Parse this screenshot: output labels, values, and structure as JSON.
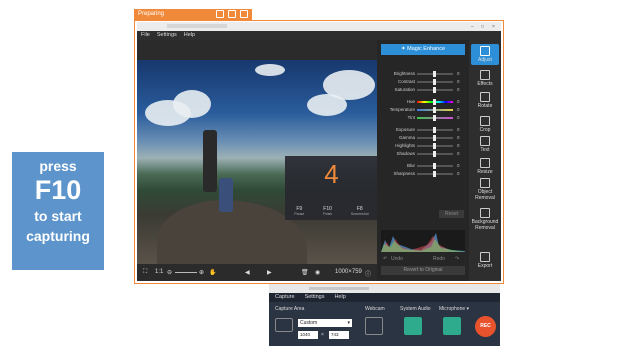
{
  "promo": {
    "line1": "press",
    "line2": "F10",
    "line3": "to start",
    "line4": "capturing"
  },
  "recording_frame": {
    "title": "Preparing",
    "accent": "#f08a3a"
  },
  "editor": {
    "menu": [
      "File",
      "Settings",
      "Help"
    ],
    "countdown": {
      "number": "4",
      "keys": [
        {
          "key": "F9",
          "caption": "Pause"
        },
        {
          "key": "F10",
          "caption": "Finish"
        },
        {
          "key": "F8",
          "caption": "Screenshot"
        }
      ]
    },
    "bottom": {
      "zoom": "1:1",
      "resolution": "1000×759"
    },
    "panel": {
      "magic_enhance": "Magic Enhance",
      "sliders": [
        {
          "label": "Brightness",
          "value": "0"
        },
        {
          "label": "Contrast",
          "value": "0"
        },
        {
          "label": "Saturation",
          "value": "0"
        },
        {
          "label": "Hue",
          "value": "0"
        },
        {
          "label": "Temperature",
          "value": "0"
        },
        {
          "label": "Tint",
          "value": "0"
        },
        {
          "label": "Exposure",
          "value": "0"
        },
        {
          "label": "Gamma",
          "value": "0"
        },
        {
          "label": "Highlights",
          "value": "0"
        },
        {
          "label": "Shadows",
          "value": "0"
        },
        {
          "label": "Blur",
          "value": "0"
        },
        {
          "label": "Sharpness",
          "value": "0"
        }
      ],
      "reset": "Reset",
      "undo": "Undo",
      "redo": "Redo",
      "revert": "Revert to Original"
    },
    "tools": [
      {
        "label": "Adjust",
        "icon": "sliders-icon",
        "active": true
      },
      {
        "label": "Effects",
        "icon": "effects-icon"
      },
      {
        "label": "Rotate",
        "icon": "rotate-icon"
      },
      {
        "label": "Crop",
        "icon": "crop-icon"
      },
      {
        "label": "Text",
        "icon": "text-icon"
      },
      {
        "label": "Resize",
        "icon": "resize-icon"
      },
      {
        "label": "Object Removal",
        "icon": "object-removal-icon"
      },
      {
        "label": "Background Removal",
        "icon": "background-removal-icon"
      },
      {
        "label": "Export",
        "icon": "export-icon"
      }
    ]
  },
  "capture": {
    "menu": [
      "Capture",
      "Settings",
      "Help"
    ],
    "capture_area": "Capture Area",
    "area_mode": "Custom",
    "width": "1040",
    "height": "743",
    "webcam": "Webcam",
    "system_audio": "System Audio",
    "microphone": "Microphone",
    "rec": "REC",
    "accent": "#2eaa8c"
  }
}
